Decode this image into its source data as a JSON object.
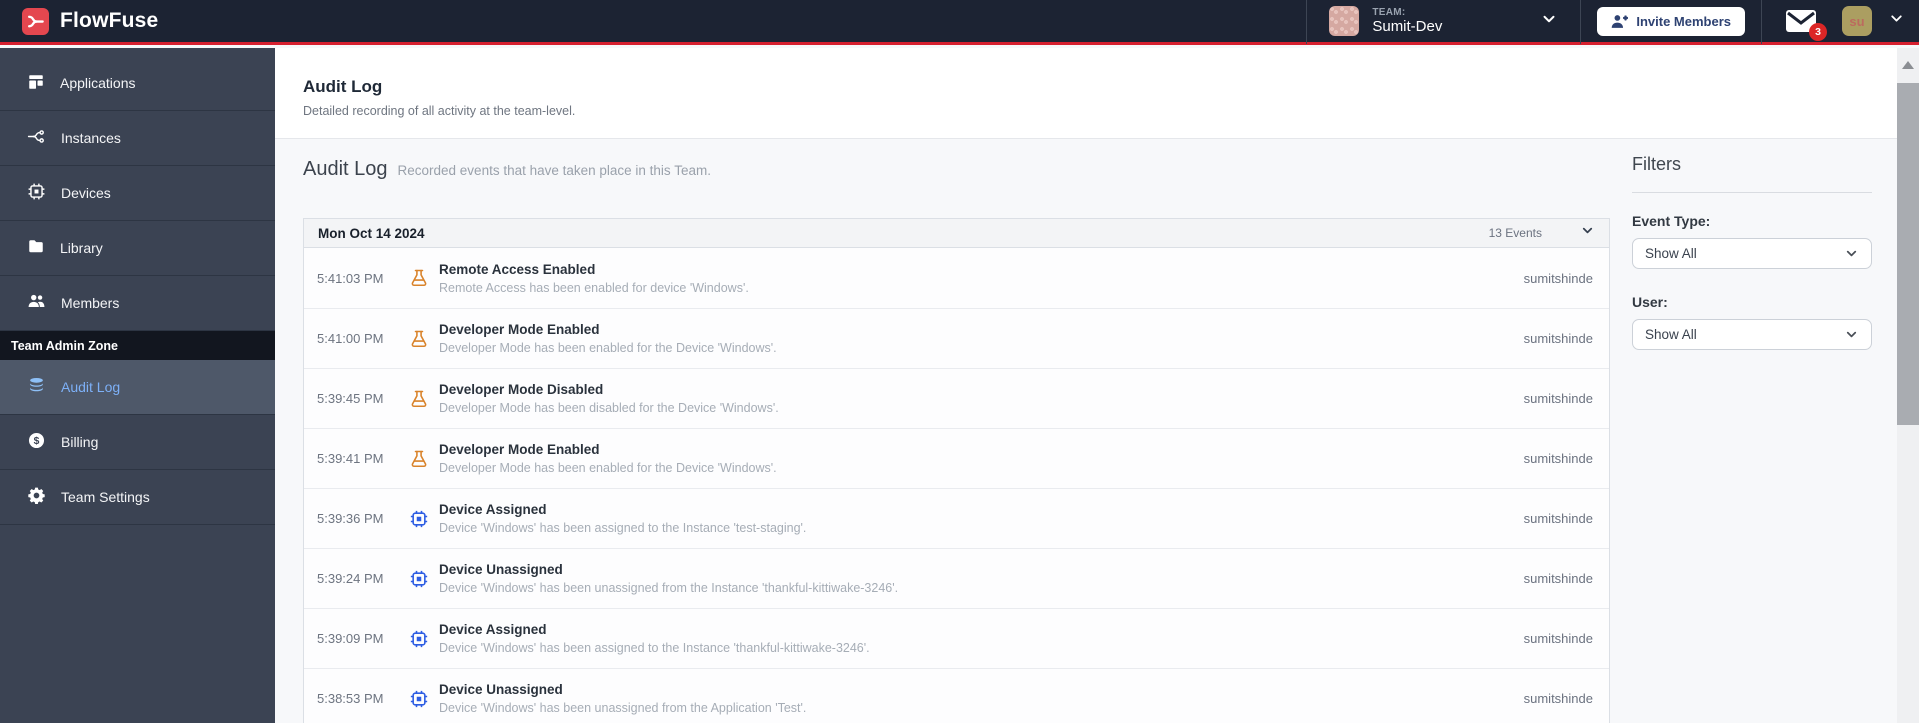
{
  "brand": {
    "name": "FlowFuse"
  },
  "navbar": {
    "team_label": "TEAM:",
    "team_name": "Sumit-Dev",
    "invite_button": "Invite Members",
    "notification_count": "3",
    "user_initials": "su"
  },
  "sidebar": {
    "items": [
      {
        "label": "Applications",
        "icon": "applications-icon"
      },
      {
        "label": "Instances",
        "icon": "instances-icon"
      },
      {
        "label": "Devices",
        "icon": "devices-icon"
      },
      {
        "label": "Library",
        "icon": "library-icon"
      },
      {
        "label": "Members",
        "icon": "members-icon"
      }
    ],
    "section_label": "Team Admin Zone",
    "admin_items": [
      {
        "label": "Audit Log",
        "icon": "audit-log-icon",
        "selected": true
      },
      {
        "label": "Billing",
        "icon": "billing-icon",
        "selected": false
      },
      {
        "label": "Team Settings",
        "icon": "team-settings-icon",
        "selected": false
      }
    ]
  },
  "header": {
    "title": "Audit Log",
    "subtitle": "Detailed recording of all activity at the team-level."
  },
  "section": {
    "title": "Audit Log",
    "subtitle": "Recorded events that have taken place in this Team."
  },
  "events": {
    "date": "Mon Oct 14 2024",
    "count_label": "13 Events",
    "rows": [
      {
        "time": "5:41:03 PM",
        "icon": "flask",
        "title": "Remote Access Enabled",
        "description": "Remote Access has been enabled for device 'Windows'.",
        "user": "sumitshinde"
      },
      {
        "time": "5:41:00 PM",
        "icon": "flask",
        "title": "Developer Mode Enabled",
        "description": "Developer Mode has been enabled for the Device 'Windows'.",
        "user": "sumitshinde"
      },
      {
        "time": "5:39:45 PM",
        "icon": "flask",
        "title": "Developer Mode Disabled",
        "description": "Developer Mode has been disabled for the Device 'Windows'.",
        "user": "sumitshinde"
      },
      {
        "time": "5:39:41 PM",
        "icon": "flask",
        "title": "Developer Mode Enabled",
        "description": "Developer Mode has been enabled for the Device 'Windows'.",
        "user": "sumitshinde"
      },
      {
        "time": "5:39:36 PM",
        "icon": "chip",
        "title": "Device Assigned",
        "description": "Device 'Windows' has been assigned to the Instance 'test-staging'.",
        "user": "sumitshinde"
      },
      {
        "time": "5:39:24 PM",
        "icon": "chip",
        "title": "Device Unassigned",
        "description": "Device 'Windows' has been unassigned from the Instance 'thankful-kittiwake-3246'.",
        "user": "sumitshinde"
      },
      {
        "time": "5:39:09 PM",
        "icon": "chip",
        "title": "Device Assigned",
        "description": "Device 'Windows' has been assigned to the Instance 'thankful-kittiwake-3246'.",
        "user": "sumitshinde"
      },
      {
        "time": "5:38:53 PM",
        "icon": "chip",
        "title": "Device Unassigned",
        "description": "Device 'Windows' has been unassigned from the Application 'Test'.",
        "user": "sumitshinde"
      }
    ]
  },
  "filters": {
    "title": "Filters",
    "event_type_label": "Event Type:",
    "event_type_value": "Show All",
    "user_label": "User:",
    "user_value": "Show All"
  },
  "colors": {
    "accent_red": "#d6202f",
    "navbar_bg": "#1c2333",
    "sidebar_bg": "#3b4353",
    "selected_item_text": "#7db0f7",
    "flask_icon": "#d9832b",
    "chip_icon": "#2d5de3",
    "badge_red": "#dc2626"
  }
}
